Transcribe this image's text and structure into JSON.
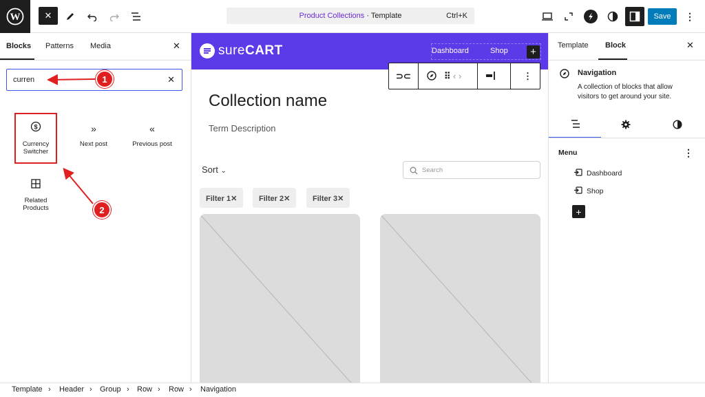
{
  "topbar": {
    "command_title_prefix": "Product Collections",
    "command_title_sep": " · ",
    "command_title_suffix": "Template",
    "command_shortcut": "Ctrl+K",
    "save_label": "Save",
    "icons": [
      "wordpress-icon",
      "close-icon",
      "pencil-icon",
      "undo-icon",
      "redo-icon",
      "list-view-icon",
      "desktop-icon",
      "fullscreen-icon",
      "surecart-icon",
      "styles-icon",
      "sidebar-icon",
      "more-icon"
    ]
  },
  "inserter": {
    "tabs": [
      "Blocks",
      "Patterns",
      "Media"
    ],
    "active_tab": "Blocks",
    "search_value": "curren",
    "blocks": [
      {
        "label": "Currency\nSwitcher",
        "label_line1": "Currency",
        "label_line2": "Switcher",
        "icon": "dollar-circle-icon"
      },
      {
        "label": "Next post",
        "icon": "double-chevron-right-icon"
      },
      {
        "label": "Previous post",
        "icon": "double-chevron-left-icon"
      },
      {
        "label": "Related\nProducts",
        "label_line1": "Related",
        "label_line2": "Products",
        "icon": "grid-icon"
      }
    ]
  },
  "canvas": {
    "logo_bold": "sure",
    "logo_rest": "CART",
    "nav": [
      "Dashboard",
      "Shop"
    ],
    "collection_name": "Collection name",
    "term_description": "Term Description",
    "sort_label": "Sort",
    "search_placeholder": "Search",
    "filters": [
      "Filter 1",
      "Filter 2",
      "Filter 3"
    ],
    "filter_remove_glyph": "✕"
  },
  "sidebar": {
    "tabs": [
      "Template",
      "Block"
    ],
    "active_tab": "Block",
    "block_title": "Navigation",
    "block_description": "A collection of blocks that allow visitors to get around your site.",
    "menu_label": "Menu",
    "menu_items": [
      "Dashboard",
      "Shop"
    ]
  },
  "breadcrumb": [
    "Template",
    "Header",
    "Group",
    "Row",
    "Row",
    "Navigation"
  ],
  "annotations": [
    "1",
    "2"
  ],
  "colors": {
    "brand_purple": "#5b3ae8",
    "accent_blue": "#007cba",
    "annotation_red": "#e02020",
    "focus_blue": "#3858e9"
  }
}
